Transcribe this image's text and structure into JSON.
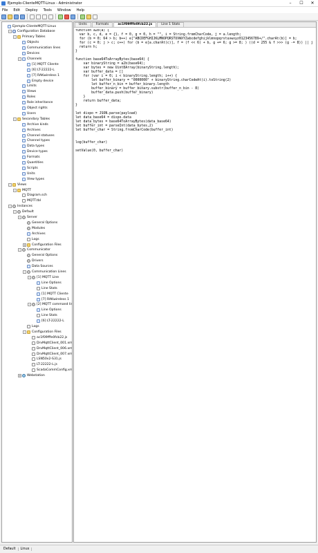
{
  "window": {
    "title": "Ejemplo-ClienteMQTT-Linux - Administrator",
    "minimize": "–",
    "maximize": "☐",
    "close": "✕"
  },
  "menu": [
    "File",
    "Edit",
    "Deploy",
    "Tools",
    "Window",
    "Help"
  ],
  "tree": [
    {
      "label": "Ejemplo-ClienteMQTT-Linux",
      "level": 0,
      "toggle": "",
      "icon": "project-icon"
    },
    {
      "label": "Configuration Database",
      "level": 1,
      "toggle": "-",
      "icon": "db-icon"
    },
    {
      "label": "Primary Tables",
      "level": 2,
      "toggle": "-",
      "icon": "folder-icon"
    },
    {
      "label": "Objects",
      "level": 3,
      "toggle": "",
      "icon": "table-icon"
    },
    {
      "label": "Communication lines",
      "level": 3,
      "toggle": "",
      "icon": "table-icon"
    },
    {
      "label": "Devices",
      "level": 3,
      "toggle": "",
      "icon": "table-icon"
    },
    {
      "label": "Channels",
      "level": 3,
      "toggle": "-",
      "icon": "table-icon"
    },
    {
      "label": "[1] MQTT Cliente",
      "level": 4,
      "toggle": "",
      "icon": "table-icon"
    },
    {
      "label": "[6] LT-22222-L",
      "level": 4,
      "toggle": "",
      "icon": "table-icon"
    },
    {
      "label": "[7] RAKwireless 1",
      "level": 4,
      "toggle": "",
      "icon": "table-icon"
    },
    {
      "label": "Empty device",
      "level": 4,
      "toggle": "",
      "icon": "table-icon"
    },
    {
      "label": "Limits",
      "level": 3,
      "toggle": "",
      "icon": "table-icon"
    },
    {
      "label": "Views",
      "level": 3,
      "toggle": "",
      "icon": "table-icon"
    },
    {
      "label": "Roles",
      "level": 3,
      "toggle": "",
      "icon": "table-icon"
    },
    {
      "label": "Role inheritance",
      "level": 3,
      "toggle": "",
      "icon": "table-icon"
    },
    {
      "label": "Object rights",
      "level": 3,
      "toggle": "",
      "icon": "table-icon"
    },
    {
      "label": "Users",
      "level": 3,
      "toggle": "",
      "icon": "table-icon"
    },
    {
      "label": "Secondary Tables",
      "level": 2,
      "toggle": "-",
      "icon": "folder-icon"
    },
    {
      "label": "Archive kinds",
      "level": 3,
      "toggle": "",
      "icon": "table-icon"
    },
    {
      "label": "Archives",
      "level": 3,
      "toggle": "",
      "icon": "table-icon"
    },
    {
      "label": "Channel statuses",
      "level": 3,
      "toggle": "",
      "icon": "table-icon"
    },
    {
      "label": "Channel types",
      "level": 3,
      "toggle": "",
      "icon": "table-icon"
    },
    {
      "label": "Data types",
      "level": 3,
      "toggle": "",
      "icon": "table-icon"
    },
    {
      "label": "Device types",
      "level": 3,
      "toggle": "",
      "icon": "table-icon"
    },
    {
      "label": "Formats",
      "level": 3,
      "toggle": "",
      "icon": "table-icon"
    },
    {
      "label": "Quantities",
      "level": 3,
      "toggle": "",
      "icon": "table-icon"
    },
    {
      "label": "Scripts",
      "level": 3,
      "toggle": "",
      "icon": "table-icon"
    },
    {
      "label": "Units",
      "level": 3,
      "toggle": "",
      "icon": "table-icon"
    },
    {
      "label": "View types",
      "level": 3,
      "toggle": "",
      "icon": "table-icon"
    },
    {
      "label": "Views",
      "level": 1,
      "toggle": "-",
      "icon": "folder-icon"
    },
    {
      "label": "MQTT",
      "level": 2,
      "toggle": "-",
      "icon": "folder-icon"
    },
    {
      "label": "Diagram.sch",
      "level": 3,
      "toggle": "",
      "icon": "file-icon"
    },
    {
      "label": "MQTT.tbl",
      "level": 3,
      "toggle": "",
      "icon": "file-icon"
    },
    {
      "label": "Instances",
      "level": 1,
      "toggle": "-",
      "icon": "gear-icon"
    },
    {
      "label": "Default",
      "level": 2,
      "toggle": "-",
      "icon": "gear-icon"
    },
    {
      "label": "Server",
      "level": 3,
      "toggle": "-",
      "icon": "gear-icon"
    },
    {
      "label": "General Options",
      "level": 4,
      "toggle": "",
      "icon": "gear-icon"
    },
    {
      "label": "Modules",
      "level": 4,
      "toggle": "",
      "icon": "gear-icon"
    },
    {
      "label": "Archives",
      "level": 4,
      "toggle": "",
      "icon": "table-icon"
    },
    {
      "label": "Logs",
      "level": 4,
      "toggle": "",
      "icon": "file-icon"
    },
    {
      "label": "Configuration Files",
      "level": 4,
      "toggle": "+",
      "icon": "folder-icon"
    },
    {
      "label": "Communicator",
      "level": 3,
      "toggle": "-",
      "icon": "gear-icon"
    },
    {
      "label": "General Options",
      "level": 4,
      "toggle": "",
      "icon": "gear-icon"
    },
    {
      "label": "Drivers",
      "level": 4,
      "toggle": "",
      "icon": "gear-icon"
    },
    {
      "label": "Data Sources",
      "level": 4,
      "toggle": "",
      "icon": "table-icon"
    },
    {
      "label": "Communication Lines",
      "level": 4,
      "toggle": "-",
      "icon": "gear-icon"
    },
    {
      "label": "[1] MQTT Line",
      "level": 5,
      "toggle": "-",
      "icon": "gear-icon"
    },
    {
      "label": "Line Options",
      "level": 6,
      "toggle": "",
      "icon": "table-icon"
    },
    {
      "label": "Line Stats",
      "level": 6,
      "toggle": "",
      "icon": "file-icon"
    },
    {
      "label": "[1] MQTT Cliente",
      "level": 6,
      "toggle": "",
      "icon": "table-icon"
    },
    {
      "label": "[7] RAKwireless 1",
      "level": 6,
      "toggle": "",
      "icon": "table-icon"
    },
    {
      "label": "[2] MQTT command line",
      "level": 5,
      "toggle": "-",
      "icon": "gear-icon"
    },
    {
      "label": "Line Options",
      "level": 6,
      "toggle": "",
      "icon": "table-icon"
    },
    {
      "label": "Line Stats",
      "level": 6,
      "toggle": "",
      "icon": "file-icon"
    },
    {
      "label": "[6] LT-22222-L",
      "level": 6,
      "toggle": "",
      "icon": "table-icon"
    },
    {
      "label": "Logs",
      "level": 4,
      "toggle": "",
      "icon": "file-icon"
    },
    {
      "label": "Configuration Files",
      "level": 4,
      "toggle": "-",
      "icon": "folder-icon"
    },
    {
      "label": "ac1f09fffe0fcb22.js",
      "level": 5,
      "toggle": "",
      "icon": "file-icon"
    },
    {
      "label": "DrvMqttClient_001.xml",
      "level": 5,
      "toggle": "",
      "icon": "file-icon"
    },
    {
      "label": "DrvMqttClient_006.xml",
      "level": 5,
      "toggle": "",
      "icon": "file-icon"
    },
    {
      "label": "DrvMqttClient_007.xml",
      "level": 5,
      "toggle": "",
      "icon": "file-icon"
    },
    {
      "label": "LSN50v2-S31.js",
      "level": 5,
      "toggle": "",
      "icon": "file-icon"
    },
    {
      "label": "LT-22222-L.js",
      "level": 5,
      "toggle": "",
      "icon": "file-icon"
    },
    {
      "label": "ScadaCommConfig.xml",
      "level": 5,
      "toggle": "",
      "icon": "file-icon"
    },
    {
      "label": "Webstation",
      "level": 3,
      "toggle": "+",
      "icon": "globe-icon"
    }
  ],
  "tabs": [
    {
      "label": "Units",
      "active": false
    },
    {
      "label": "Formats",
      "active": false
    },
    {
      "label": "ac1f09fffe0fcb22.js",
      "active": true
    },
    {
      "label": "Line 1 Stats",
      "active": false
    }
  ],
  "code": [
    "function a2b(a) {",
    "  var b, c, d, e = {}, f = 0, g = 0, h = \"\", i = String.fromCharCode, j = a.length;",
    "  for (b = 0; 64 > b; b++) e[\"ABCDEFGHIJKLMNOPQRSTUVWXYZabcdefghijklmnopqrstuvwxyz0123456789+/\".charAt(b)] = b;",
    "  for (c = 0; j > c; c++) for (b = e[a.charAt(c)], f = (f << 6) + b, g += 6; g >= 8; ) ((d = 255 & f >>> (g -= 8)) || j",
    "  return h;",
    "}",
    "",
    "function base64ToArrayBytes(base64) {",
    "    var binaryString = a2b(base64);",
    "    var bytes = new Uint8Array(binaryString.length);",
    "    var buffer_data = []",
    "    for (var i = 0; i < binaryString.length; i++) {",
    "        let buffer_binary = \"0000000\" + binaryString.charCodeAt(i).toString(2)",
    "        let buffer_n_bin = buffer_binary.length",
    "        buffer_binary = buffer_binary.substr(buffer_n_bin - 8)",
    "        buffer_data.push(buffer_binary)",
    "    }",
    "    return buffer_data;",
    "}",
    "",
    "let dispo = JSON.parse(payload)",
    "let data_base64 = dispo.data",
    "let data_bytes = base64ToArrayBytes(data_base64)",
    "let buffer_int = parseInt(data_bytes,2)",
    "let buffer_char = String.fromCharCode(buffer_int)",
    "",
    "",
    "log(buffer_char)",
    "",
    "setValue(0, buffer_char)"
  ],
  "status": [
    "Default",
    "Linux"
  ]
}
